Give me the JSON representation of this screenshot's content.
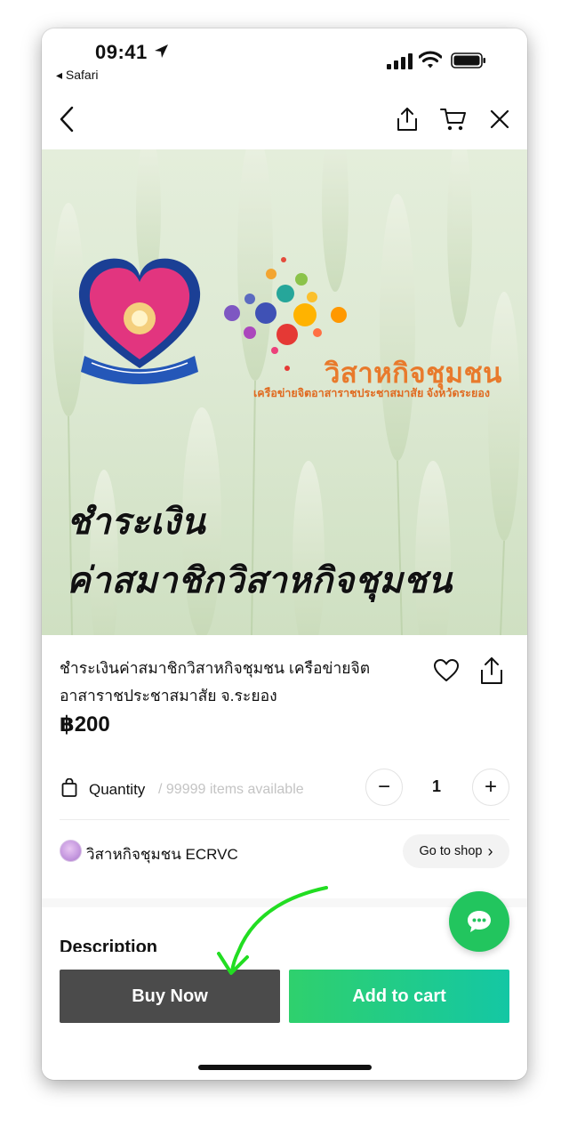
{
  "status_bar": {
    "time": "09:41",
    "back_app": "◂ Safari"
  },
  "nav": {
    "back_icon": "chevron-left-icon",
    "share_icon": "share-icon",
    "cart_icon": "cart-icon",
    "close_icon": "close-icon"
  },
  "banner": {
    "org_name": "วิสาหกิจชุมชน",
    "org_subtitle": "เครือข่ายจิตอาสาราชประชาสมาสัย จังหวัดระยอง",
    "headline_1": "ชำระเงิน",
    "headline_2": "ค่าสมาชิกวิสาหกิจชุมชน"
  },
  "product": {
    "title": "ชำระเงินค่าสมาชิกวิสาหกิจชุมชน เครือข่ายจิตอาสาราชประชาสมาสัย จ.ระยอง",
    "price": "฿200"
  },
  "quantity": {
    "label": "Quantity",
    "available": "/ 99999 items available",
    "value": "1",
    "minus": "−",
    "plus": "+"
  },
  "shop": {
    "name": "วิสาหกิจชุมชน ECRVC",
    "go_to_shop": "Go to shop",
    "chevron": "›"
  },
  "description": {
    "heading": "Description"
  },
  "actions": {
    "buy_now": "Buy Now",
    "add_to_cart": "Add to cart"
  },
  "colors": {
    "buy_now_bg": "#4b4b4b",
    "add_cart_start": "#2fd06d",
    "add_cart_end": "#14c7a4",
    "chat_fab": "#22c55e",
    "annotation_arrow": "#22dd22"
  }
}
